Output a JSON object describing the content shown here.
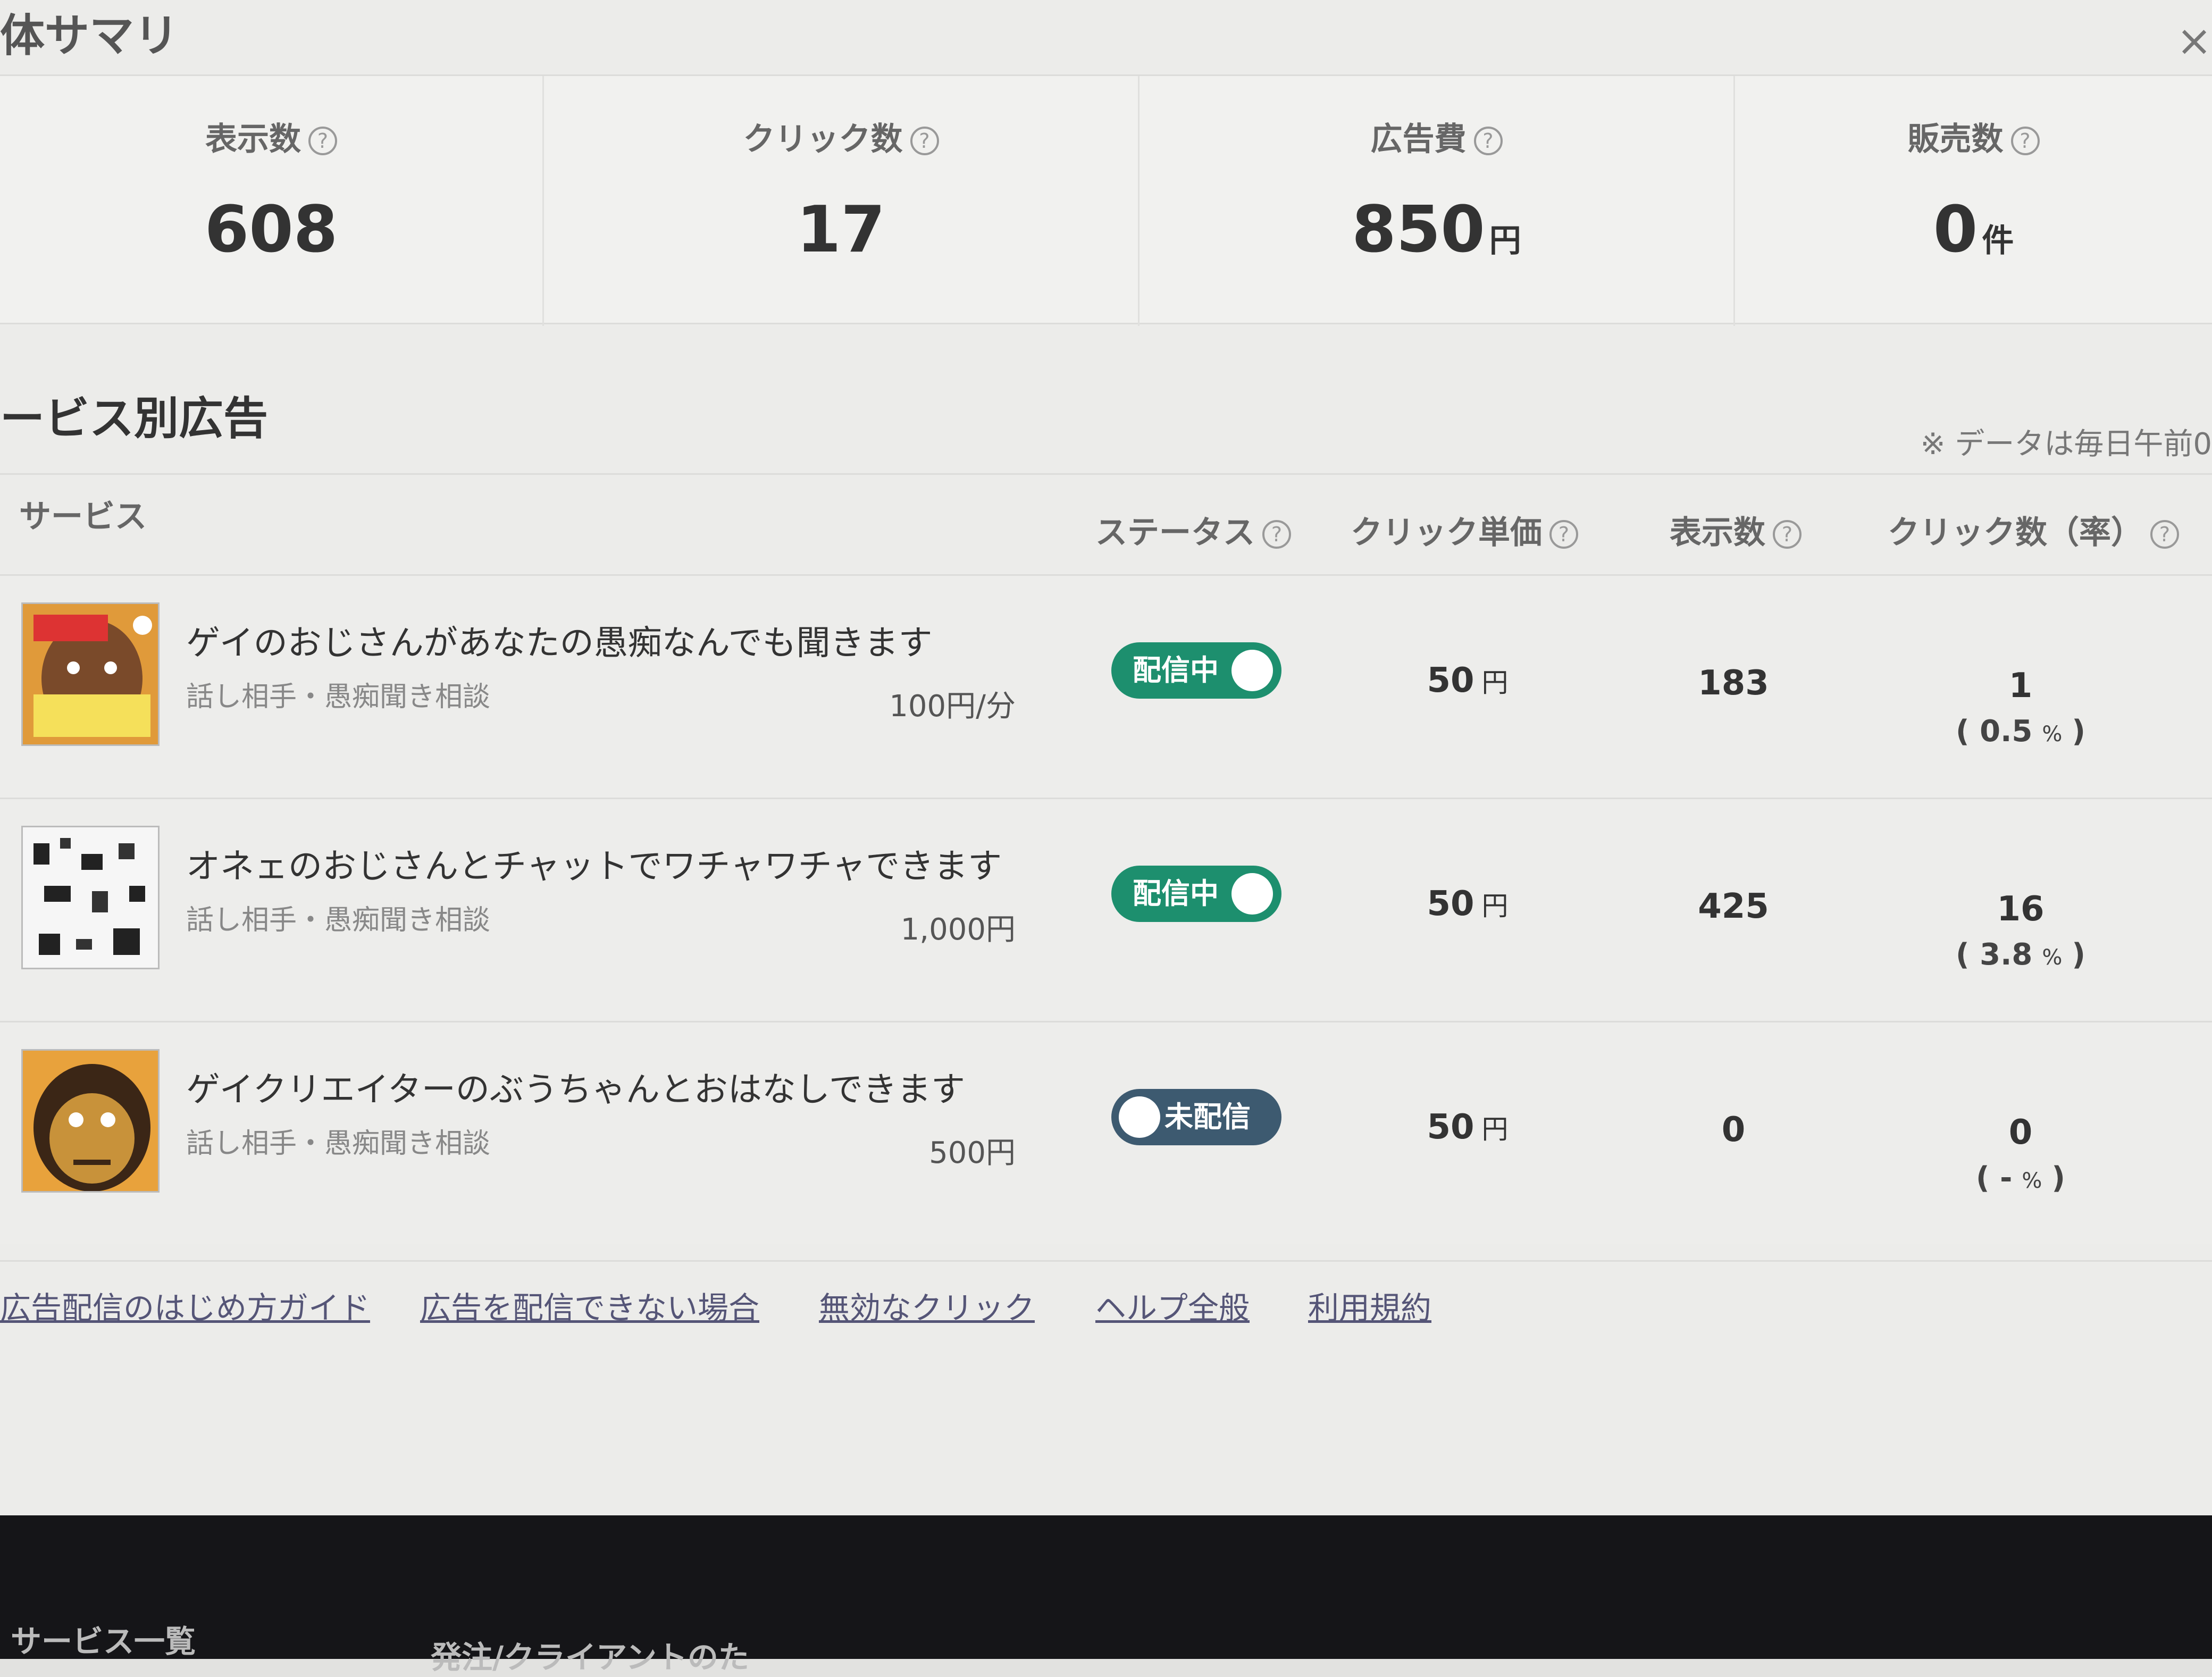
{
  "summary": {
    "title": "体サマリ",
    "close": "×",
    "stats": [
      {
        "label": "表示数",
        "value": "608",
        "unit": ""
      },
      {
        "label": "クリック数",
        "value": "17",
        "unit": ""
      },
      {
        "label": "広告費",
        "value": "850",
        "unit": "円"
      },
      {
        "label": "販売数",
        "value": "0",
        "unit": "件"
      }
    ]
  },
  "ads": {
    "title": "ービス別広告",
    "note": "※ データは毎日午前0",
    "headers": {
      "service": "サービス",
      "status": "ステータス",
      "cpc": "クリック単価",
      "impressions": "表示数",
      "clicks": "クリック数（率）"
    },
    "help_glyph": "?",
    "yen": "円",
    "pct": "%",
    "rows": [
      {
        "title": "ゲイのおじさんがあなたの愚痴なんでも聞きます",
        "category": "話し相手・愚痴聞き相談",
        "price": "100円/分",
        "status": "配信中",
        "status_on": true,
        "cpc": "50",
        "impressions": "183",
        "clicks": "1",
        "rate": "0.5"
      },
      {
        "title": "オネェのおじさんとチャットでワチャワチャできます",
        "category": "話し相手・愚痴聞き相談",
        "price": "1,000円",
        "status": "配信中",
        "status_on": true,
        "cpc": "50",
        "impressions": "425",
        "clicks": "16",
        "rate": "3.8"
      },
      {
        "title": "ゲイクリエイターのぶうちゃんとおはなしできます",
        "category": "話し相手・愚痴聞き相談",
        "price": "500円",
        "status": "未配信",
        "status_on": false,
        "cpc": "50",
        "impressions": "0",
        "clicks": "0",
        "rate": "-"
      }
    ]
  },
  "links": [
    "広告配信のはじめ方ガイド",
    "広告を配信できない場合",
    "無効なクリック",
    "ヘルプ全般",
    "利用規約"
  ],
  "bottom_nav": {
    "left": "サービス一覧",
    "middle": "発注/クライアントのた"
  },
  "colors": {
    "status_on": "#1d8f6e",
    "status_off": "#3d5a70"
  }
}
